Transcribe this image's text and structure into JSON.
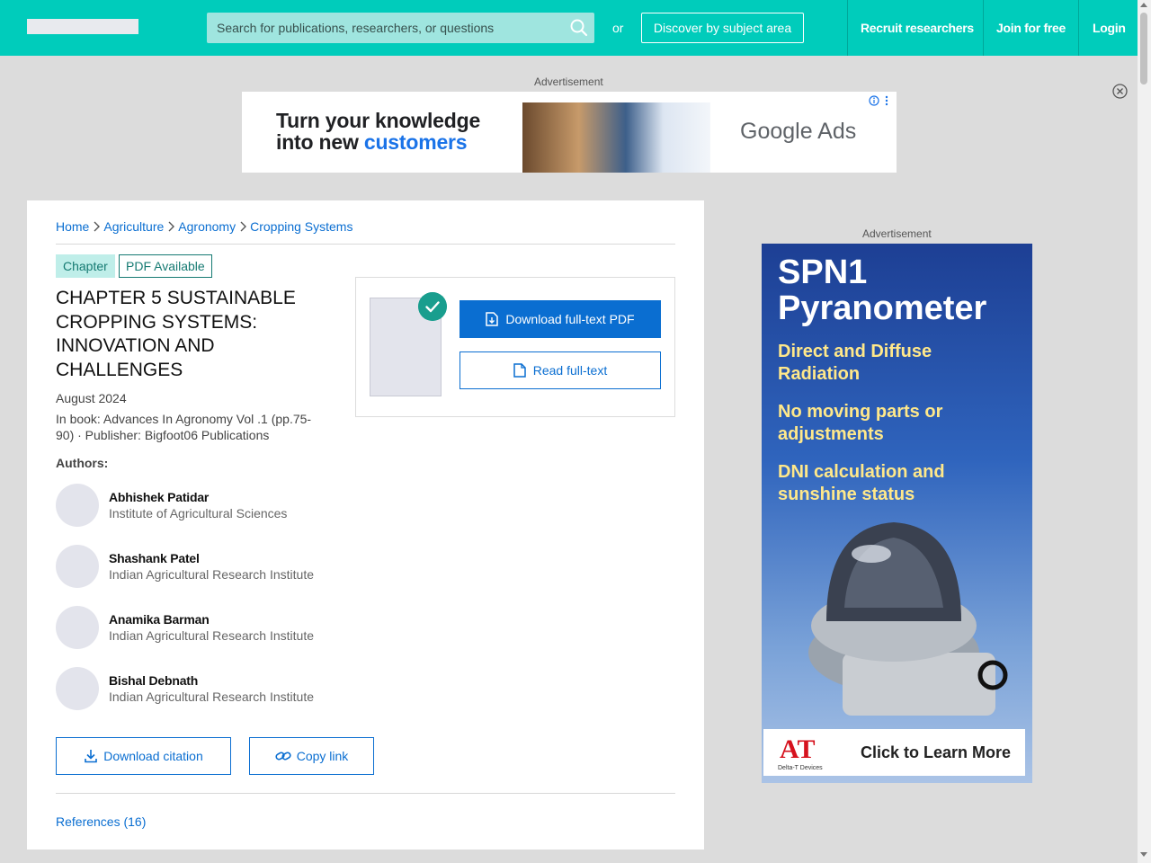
{
  "header": {
    "search_placeholder": "Search for publications, researchers, or questions",
    "or_text": "or",
    "discover_label": "Discover by subject area",
    "nav": [
      "Recruit researchers",
      "Join for free",
      "Login"
    ]
  },
  "top_ad": {
    "label": "Advertisement",
    "headline_line1": "Turn your knowledge",
    "headline_line2_prefix": "into new ",
    "headline_line2_highlight": "customers",
    "brand": "Google Ads"
  },
  "breadcrumb": [
    "Home",
    "Agriculture",
    "Agronomy",
    "Cropping Systems"
  ],
  "publication": {
    "type_badge": "Chapter",
    "availability_badge": "PDF Available",
    "title": "CHAPTER 5 SUSTAINABLE CROPPING SYSTEMS: INNOVATION AND CHALLENGES",
    "date": "August 2024",
    "book_info": "In book: Advances In Agronomy Vol .1 (pp.75-90) · Publisher: Bigfoot06 Publications",
    "authors_label": "Authors:",
    "authors": [
      {
        "name": "Abhishek Patidar",
        "institution": "Institute of Agricultural Sciences"
      },
      {
        "name": "Shashank Patel",
        "institution": "Indian Agricultural Research Institute"
      },
      {
        "name": "Anamika Barman",
        "institution": "Indian Agricultural Research Institute"
      },
      {
        "name": "Bishal Debnath",
        "institution": "Indian Agricultural Research Institute"
      }
    ]
  },
  "actions": {
    "download_pdf": "Download full-text PDF",
    "read_fulltext": "Read full-text",
    "download_citation": "Download citation",
    "copy_link": "Copy link",
    "references": "References (16)"
  },
  "side_ad": {
    "label": "Advertisement",
    "headline": "SPN1 Pyranometer",
    "features": [
      "Direct and Diffuse Radiation",
      "No moving parts or adjustments",
      "DNI calculation and sunshine status"
    ],
    "brand_logo": "AT",
    "brand_name": "Delta-T Devices",
    "cta": "Click to Learn More"
  },
  "colors": {
    "header_teal": "#00ccbb",
    "link_blue": "#0a6ed1",
    "badge_teal": "#157a72",
    "check_green": "#199e8e"
  }
}
